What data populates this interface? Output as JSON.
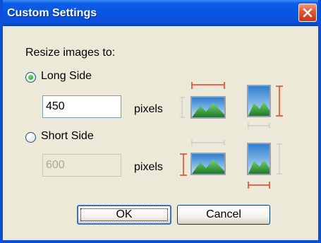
{
  "window": {
    "title": "Custom Settings"
  },
  "prompt": "Resize images to:",
  "long_side": {
    "label": "Long Side",
    "selected": true,
    "value": "450",
    "unit": "pixels"
  },
  "short_side": {
    "label": "Short Side",
    "selected": false,
    "value": "600",
    "unit": "pixels"
  },
  "buttons": {
    "ok": "OK",
    "cancel": "Cancel"
  },
  "colors": {
    "titlebar": "#0a4fd6",
    "close_button": "#e0532c",
    "measure_active": "#e8401c",
    "measure_inactive": "#c8c8c8",
    "dialog_bg": "#ece9d8"
  },
  "icons": [
    "close-icon",
    "landscape-width-measure-icon",
    "portrait-height-measure-icon",
    "landscape-height-measure-icon",
    "portrait-width-measure-icon"
  ]
}
